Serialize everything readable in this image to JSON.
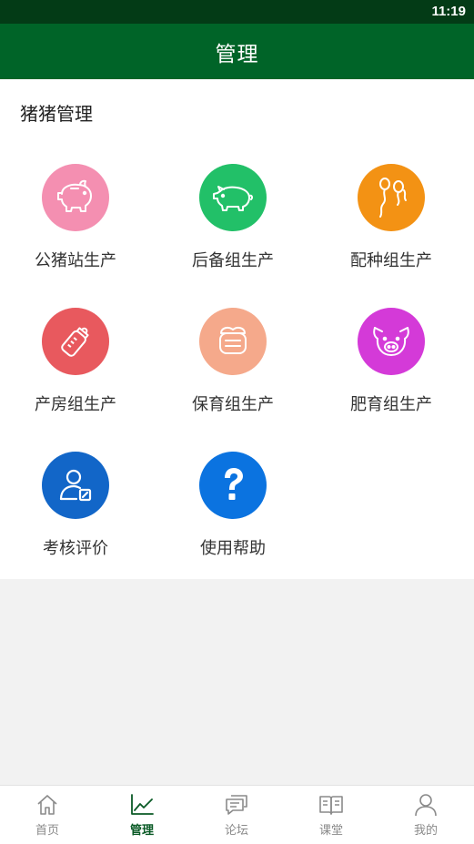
{
  "status_bar": {
    "time": "11:19"
  },
  "header": {
    "title": "管理"
  },
  "section": {
    "title": "猪猪管理"
  },
  "tiles": [
    {
      "label": "公猪站生产",
      "icon": "piggy-bank-icon",
      "color": "#f48fb1"
    },
    {
      "label": "后备组生产",
      "icon": "pig-icon",
      "color": "#22c068"
    },
    {
      "label": "配种组生产",
      "icon": "sperm-icon",
      "color": "#f39214"
    },
    {
      "label": "产房组生产",
      "icon": "baby-bottle-icon",
      "color": "#e8595e"
    },
    {
      "label": "保育组生产",
      "icon": "food-jar-icon",
      "color": "#f5a98b"
    },
    {
      "label": "肥育组生产",
      "icon": "pig-face-icon",
      "color": "#d43ad8"
    },
    {
      "label": "考核评价",
      "icon": "user-edit-icon",
      "color": "#1266c8"
    },
    {
      "label": "使用帮助",
      "icon": "question-icon",
      "color": "#0b73e0"
    }
  ],
  "bottom_nav": [
    {
      "label": "首页",
      "icon": "home-icon",
      "active": false
    },
    {
      "label": "管理",
      "icon": "chart-icon",
      "active": true
    },
    {
      "label": "论坛",
      "icon": "chat-icon",
      "active": false
    },
    {
      "label": "课堂",
      "icon": "book-icon",
      "active": false
    },
    {
      "label": "我的",
      "icon": "user-icon",
      "active": false
    }
  ]
}
